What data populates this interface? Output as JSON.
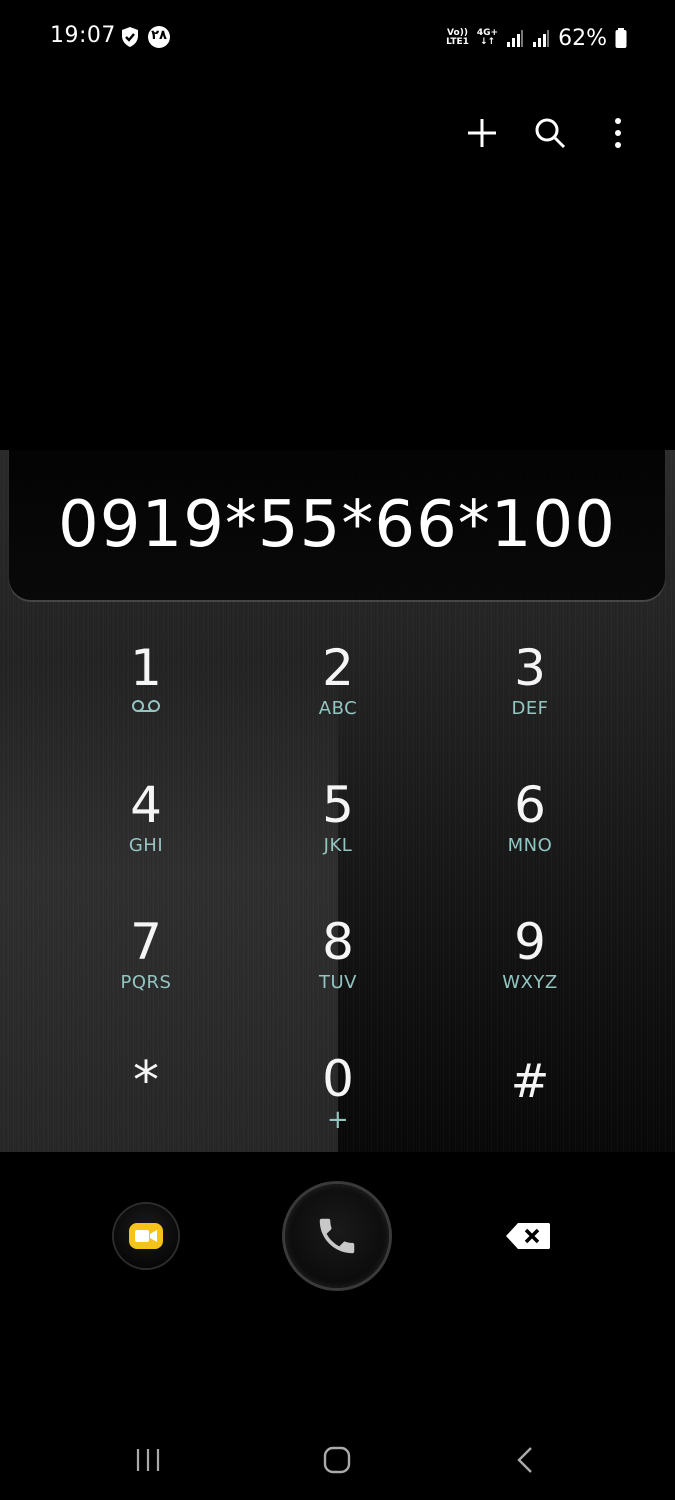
{
  "status_bar": {
    "time": "19:07",
    "badge_text": "۲۸",
    "network_top": "Vo))",
    "network_bottom": "LTE1",
    "data_top": "4G+",
    "battery": "62%"
  },
  "toolbar": {
    "add": "add-icon",
    "search": "search-icon",
    "more": "more-icon"
  },
  "dialer": {
    "number": "0919*55*66*100"
  },
  "keypad": {
    "keys": [
      {
        "digit": "1",
        "letters": ""
      },
      {
        "digit": "2",
        "letters": "ABC"
      },
      {
        "digit": "3",
        "letters": "DEF"
      },
      {
        "digit": "4",
        "letters": "GHI"
      },
      {
        "digit": "5",
        "letters": "JKL"
      },
      {
        "digit": "6",
        "letters": "MNO"
      },
      {
        "digit": "7",
        "letters": "PQRS"
      },
      {
        "digit": "8",
        "letters": "TUV"
      },
      {
        "digit": "9",
        "letters": "WXYZ"
      },
      {
        "digit": "*",
        "letters": ""
      },
      {
        "digit": "0",
        "letters": "+"
      },
      {
        "digit": "#",
        "letters": ""
      }
    ]
  },
  "colors": {
    "letters": "#93c5c1",
    "video_yellow": "#f6c31a"
  }
}
